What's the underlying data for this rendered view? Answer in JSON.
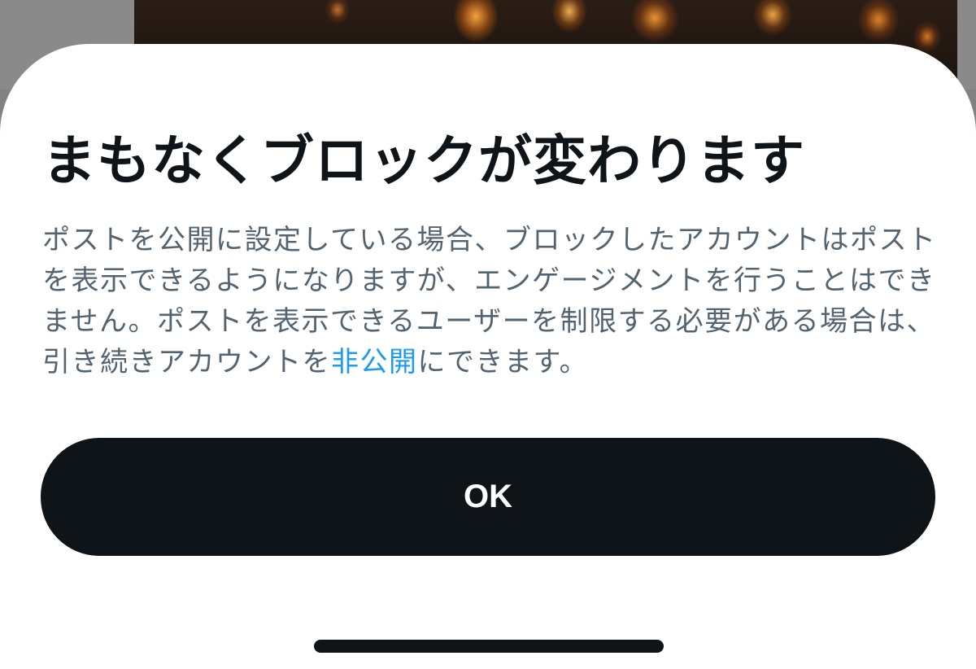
{
  "dialog": {
    "title": "まもなくブロックが変わります",
    "body_before_link": "ポストを公開に設定している場合、ブロックしたアカウントはポストを表示できるようになりますが、エンゲージメントを行うことはできません。ポストを表示できるユーザーを制限する必要がある場合は、引き続きアカウントを",
    "link_text": "非公開",
    "body_after_link": "にできます。",
    "ok_label": "OK"
  },
  "colors": {
    "title": "#0f1419",
    "body": "#536471",
    "link": "#1d9bf0",
    "button_bg": "#0f1419",
    "button_text": "#ffffff",
    "backdrop": "#828282"
  }
}
